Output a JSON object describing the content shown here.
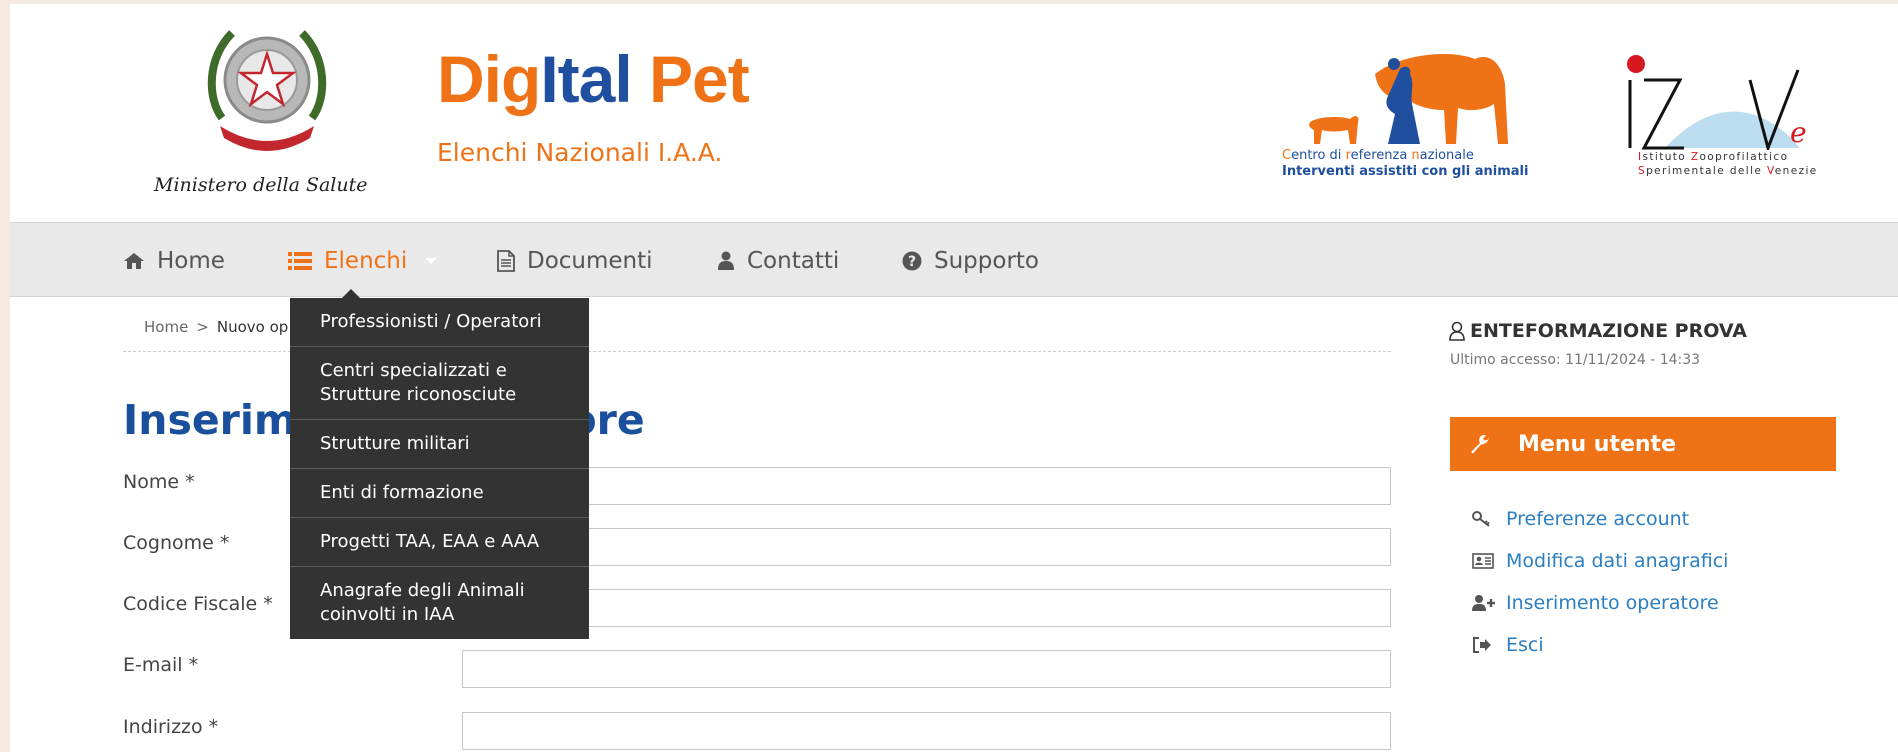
{
  "header": {
    "ministry_caption": "Ministero della Salute",
    "brand_part1": "Dig",
    "brand_part2": "Ital",
    "brand_part3": " Pet",
    "brand_subtitle": "Elenchi Nazionali I.A.A.",
    "centro_line1_parts": [
      "C",
      "entro di ",
      "r",
      "eferenza ",
      "n",
      "azionale"
    ],
    "centro_line2": "Interventi assistiti con gli animali",
    "izsve_line1_parts": [
      "I",
      "stituto ",
      "Z",
      "ooprofilattico"
    ],
    "izsve_line2_parts": [
      "S",
      "perimentale delle ",
      "V",
      "enezie"
    ],
    "colors": {
      "orange": "#ef7316",
      "blue": "#1f4f9e",
      "red": "#d6171e"
    }
  },
  "nav": {
    "items": [
      {
        "label": "Home",
        "icon": "home-icon"
      },
      {
        "label": "Elenchi",
        "icon": "list-icon",
        "active": true
      },
      {
        "label": "Documenti",
        "icon": "document-icon"
      },
      {
        "label": "Contatti",
        "icon": "user-icon"
      },
      {
        "label": "Supporto",
        "icon": "question-circle-icon"
      }
    ]
  },
  "dropdown": {
    "items": [
      "Professionisti / Operatori",
      "Centri specializzati e\nStrutture riconosciute",
      "Strutture militari",
      "Enti di formazione",
      "Progetti TAA, EAA e AAA",
      "Anagrafe degli Animali\ncoinvolti in IAA"
    ]
  },
  "breadcrumb": {
    "home": "Home",
    "separator": ">",
    "current": "Nuovo op"
  },
  "page_title": "Inserimento operatore",
  "form": {
    "fields": [
      {
        "label": "Nome *",
        "value": ""
      },
      {
        "label": "Cognome *",
        "value": ""
      },
      {
        "label": "Codice Fiscale *",
        "value": ""
      },
      {
        "label": "E-mail *",
        "value": ""
      },
      {
        "label": "Indirizzo *",
        "value": ""
      }
    ]
  },
  "sidebar": {
    "user_name": "ENTEFORMAZIONE PROVA",
    "last_access": "Ultimo accesso: 11/11/2024 - 14:33",
    "menu_title": "Menu utente",
    "menu_items": [
      {
        "label": "Preferenze account",
        "icon": "key-icon"
      },
      {
        "label": "Modifica dati anagrafici",
        "icon": "id-card-icon"
      },
      {
        "label": "Inserimento operatore",
        "icon": "user-plus-icon"
      },
      {
        "label": "Esci",
        "icon": "sign-out-icon"
      }
    ]
  }
}
